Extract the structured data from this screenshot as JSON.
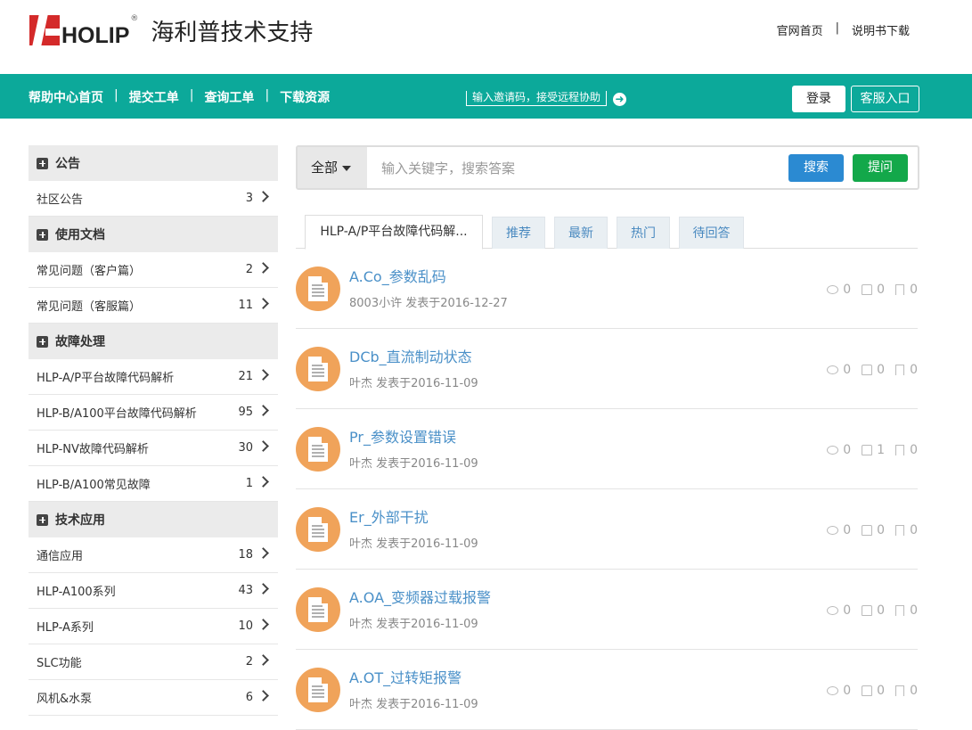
{
  "header": {
    "logo_text": "HOLIP",
    "logo_reg": "®",
    "site_title": "海利普技术支持",
    "links": [
      "官网首页",
      "说明书下载"
    ],
    "link_sep": "|"
  },
  "nav": {
    "items": [
      "帮助中心首页",
      "提交工单",
      "查询工单",
      "下载资源"
    ],
    "sep": "|",
    "invite_text": "输入邀请码，接受远程协助",
    "login": "登录",
    "service": "客服入口"
  },
  "sidebar": [
    {
      "title": "公告",
      "items": [
        {
          "label": "社区公告",
          "count": "3"
        }
      ]
    },
    {
      "title": "使用文档",
      "items": [
        {
          "label": "常见问题（客户篇）",
          "count": "2"
        },
        {
          "label": "常见问题（客服篇）",
          "count": "11"
        }
      ]
    },
    {
      "title": "故障处理",
      "items": [
        {
          "label": "HLP-A/P平台故障代码解析",
          "count": "21"
        },
        {
          "label": "HLP-B/A100平台故障代码解析",
          "count": "95"
        },
        {
          "label": "HLP-NV故障代码解析",
          "count": "30"
        },
        {
          "label": "HLP-B/A100常见故障",
          "count": "1"
        }
      ]
    },
    {
      "title": "技术应用",
      "items": [
        {
          "label": "通信应用",
          "count": "18"
        },
        {
          "label": "HLP-A100系列",
          "count": "43"
        },
        {
          "label": "HLP-A系列",
          "count": "10"
        },
        {
          "label": "SLC功能",
          "count": "2"
        },
        {
          "label": "风机&水泵",
          "count": "6"
        }
      ]
    }
  ],
  "search": {
    "scope": "全部",
    "placeholder": "输入关键字，搜索答案",
    "search_btn": "搜索",
    "ask_btn": "提问"
  },
  "tabs": [
    "HLP-A/P平台故障代码解...",
    "推荐",
    "最新",
    "热门",
    "待回答"
  ],
  "posts": [
    {
      "title": "A.Co_参数乱码",
      "meta": "8003小许 发表于2016-12-27",
      "comments": "0",
      "likes": "0",
      "favs": "0"
    },
    {
      "title": "DCb_直流制动状态",
      "meta": "叶杰 发表于2016-11-09",
      "comments": "0",
      "likes": "0",
      "favs": "0"
    },
    {
      "title": "Pr_参数设置错误",
      "meta": "叶杰 发表于2016-11-09",
      "comments": "0",
      "likes": "1",
      "favs": "0"
    },
    {
      "title": "Er_外部干扰",
      "meta": "叶杰 发表于2016-11-09",
      "comments": "0",
      "likes": "0",
      "favs": "0"
    },
    {
      "title": "A.OA_变频器过载报警",
      "meta": "叶杰 发表于2016-11-09",
      "comments": "0",
      "likes": "0",
      "favs": "0"
    },
    {
      "title": "A.OT_过转矩报警",
      "meta": "叶杰 发表于2016-11-09",
      "comments": "0",
      "likes": "0",
      "favs": "0"
    }
  ],
  "colors": {
    "nav_bg": "#0ca99a",
    "link": "#4a90c8",
    "search_btn": "#2b8ad2",
    "ask_btn": "#13a84a",
    "avatar": "#f0a35a"
  }
}
